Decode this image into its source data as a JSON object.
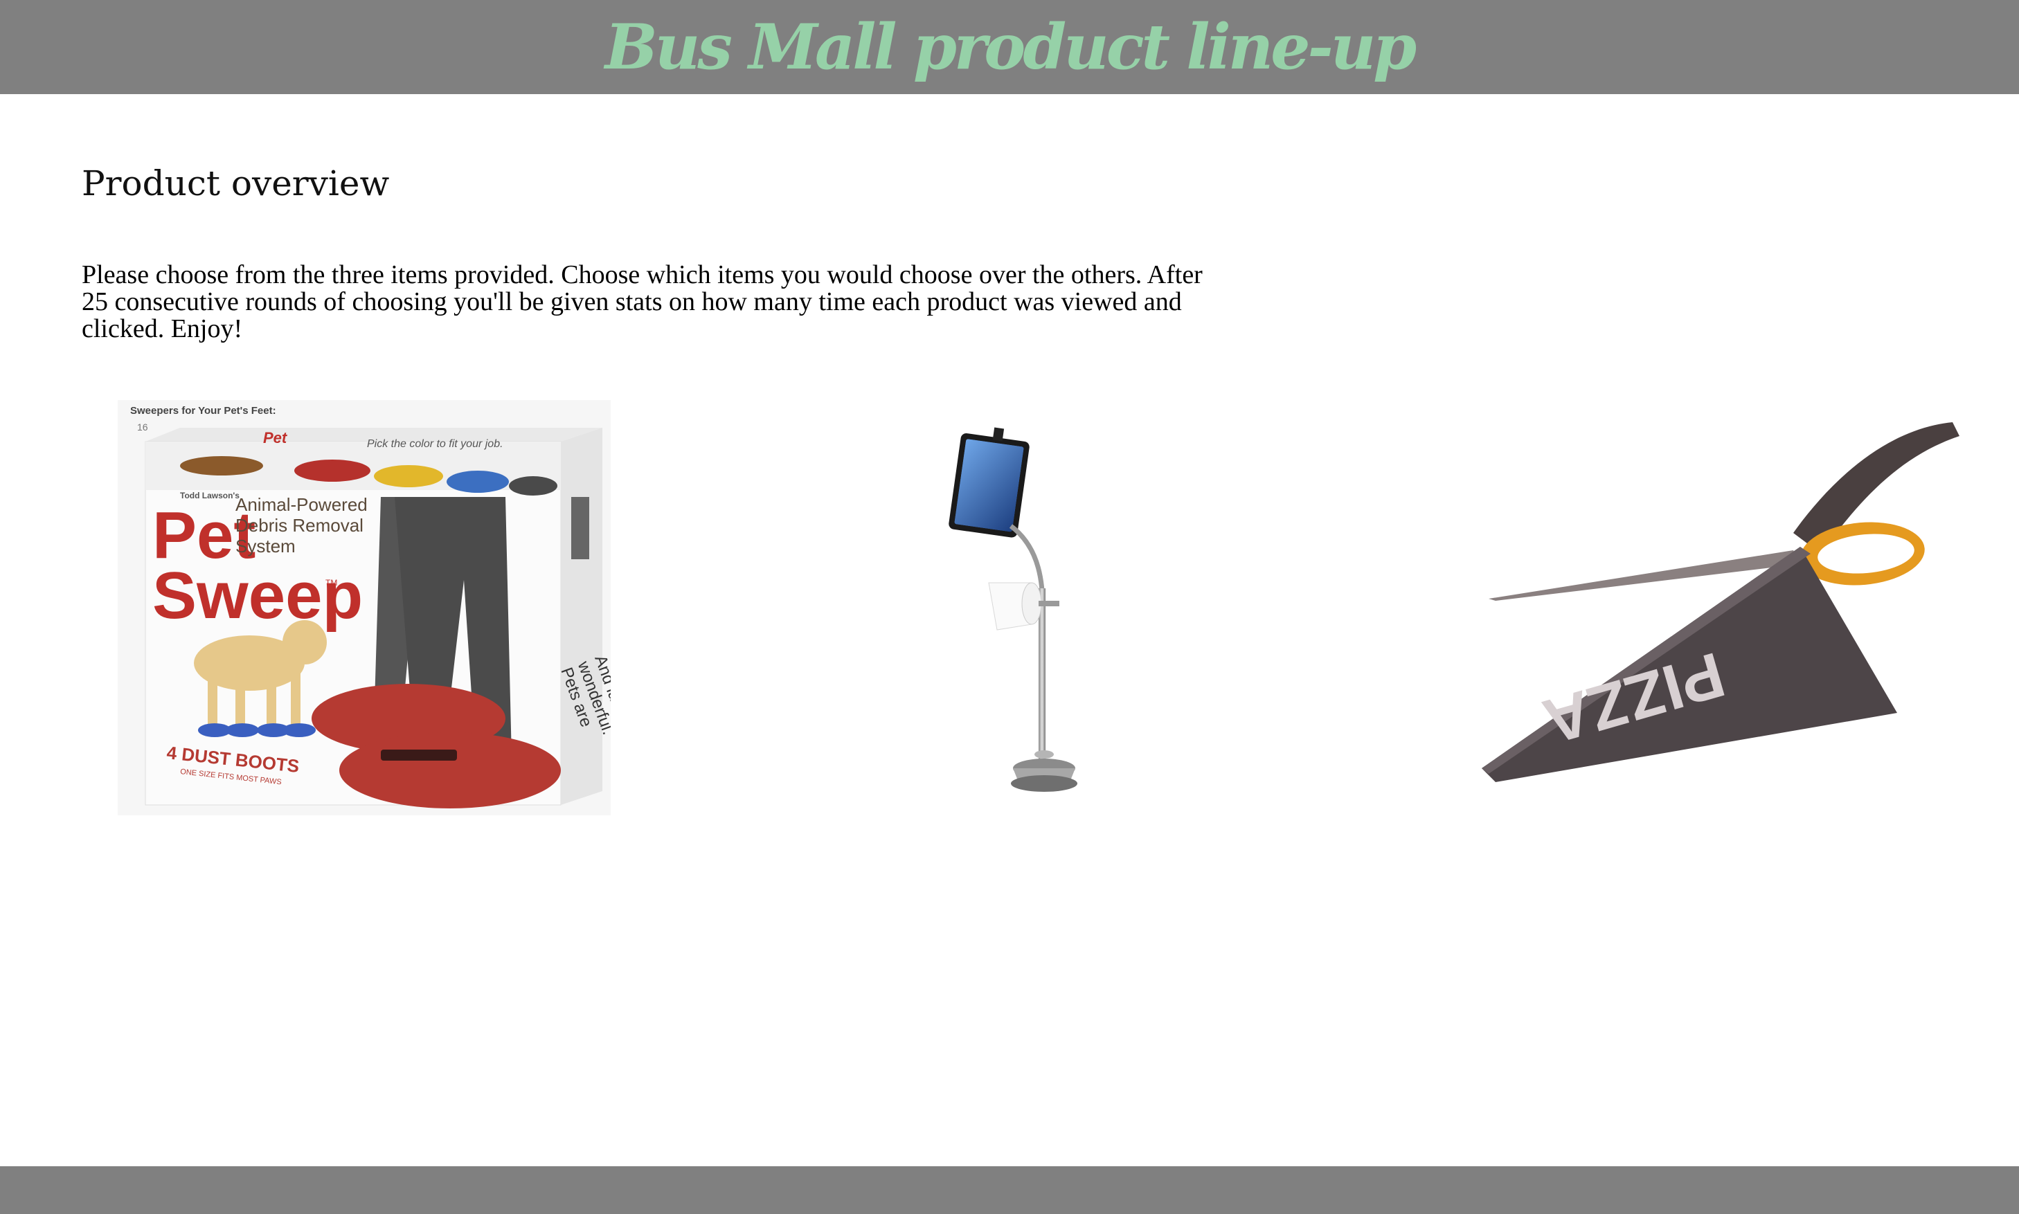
{
  "header": {
    "title": "Bus Mall product line-up",
    "background": "#808080",
    "title_color": "#96d1a8"
  },
  "main": {
    "heading": "Product overview",
    "instructions": "Please choose from the three items provided. Choose which items you would choose over the others. After 25 consecutive rounds of choosing you'll be given stats on how many time each product was viewed and clicked. Enjoy!"
  },
  "products": [
    {
      "icon": "pet-sweep-box-image",
      "box_caption": "Sweepers for Your Pet's Feet:",
      "box_number": "16",
      "brand_small": "Todd Lawson's",
      "brand_line1": "Pet",
      "brand_line2": "Sweep",
      "trademark": "TM",
      "tagline_line1": "Animal-Powered",
      "tagline_line2": "Debris Removal",
      "tagline_line3": "System",
      "top_banner": "Pick the color to fit your job.",
      "side_text_line1": "Pets are",
      "side_text_line2": "wonderful.",
      "side_text_line3": "And lazy.",
      "boots_line1": "4 DUST BOOTS",
      "boots_line2": "ONE SIZE FITS MOST PAWS"
    },
    {
      "icon": "ipad-toilet-paper-stand-image"
    },
    {
      "icon": "pizza-scissors-image",
      "blade_text": "PIZZA"
    }
  ],
  "footer": {
    "background": "#808080"
  }
}
